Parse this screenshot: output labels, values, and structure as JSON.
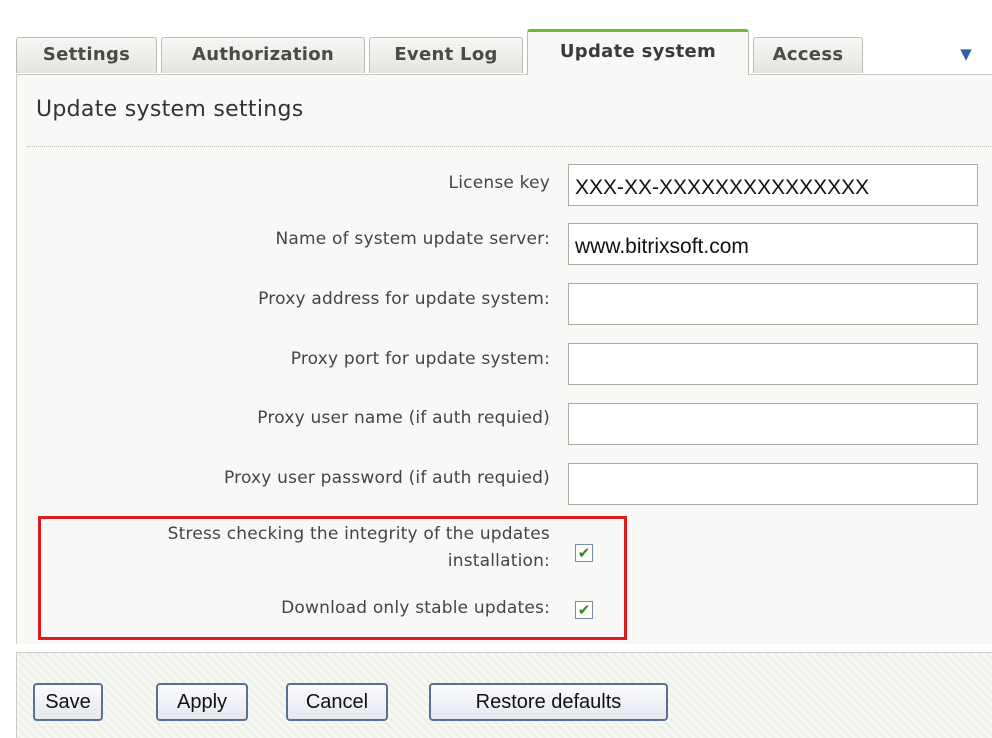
{
  "tabs": [
    {
      "label": "Settings",
      "active": false
    },
    {
      "label": "Authorization",
      "active": false
    },
    {
      "label": "Event Log",
      "active": false
    },
    {
      "label": "Update system",
      "active": true
    },
    {
      "label": "Access",
      "active": false
    }
  ],
  "panel": {
    "title": "Update system settings",
    "fields": {
      "license_key": {
        "label": "License key",
        "value": "XXX-XX-XXXXXXXXXXXXXXX"
      },
      "update_server": {
        "label": "Name of system update server:",
        "value": "www.bitrixsoft.com"
      },
      "proxy_address": {
        "label": "Proxy address for update system:",
        "value": ""
      },
      "proxy_port": {
        "label": "Proxy port for update system:",
        "value": ""
      },
      "proxy_user": {
        "label": "Proxy user name (if auth requied)",
        "value": ""
      },
      "proxy_password": {
        "label": "Proxy user password (if auth requied)",
        "value": ""
      }
    },
    "checks": {
      "stress_check": {
        "label_line1": "Stress checking the integrity of the updates",
        "label_line2": "installation:",
        "checked": true,
        "mark": "✔"
      },
      "stable_only": {
        "label": "Download only stable updates:",
        "checked": true,
        "mark": "✔"
      }
    }
  },
  "footer": {
    "save": "Save",
    "apply": "Apply",
    "cancel": "Cancel",
    "restore": "Restore defaults"
  },
  "icons": {
    "tab_menu": "chevron-down-icon"
  },
  "colors": {
    "active_tab_accent": "#6dbb2b",
    "highlight": "#e0191f",
    "check": "#2e8b1f",
    "button_border": "#5b7190"
  }
}
